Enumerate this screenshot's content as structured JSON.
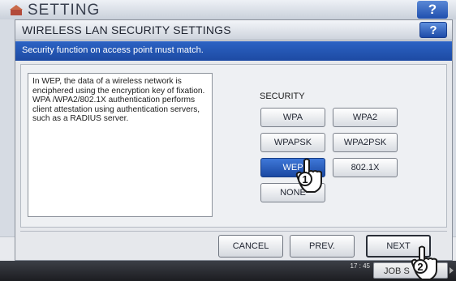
{
  "background": {
    "title": "SETTING",
    "help_label": "?",
    "taskbar": {
      "time": "17 : 45",
      "job_button": "JOB S"
    }
  },
  "dialog": {
    "title": "WIRELESS LAN SECURITY SETTINGS",
    "help_label": "?",
    "banner": "Security function on access point must match.",
    "description": "In WEP, the data of a wireless network is enciphered using the encryption key of fixation. WPA /WPA2/802.1X authentication performs client attestation using authentication servers, such as a RADIUS server.",
    "security_label": "SECURITY",
    "security_options": [
      {
        "label": "WPA",
        "selected": false
      },
      {
        "label": "WPA2",
        "selected": false
      },
      {
        "label": "WPAPSK",
        "selected": false
      },
      {
        "label": "WPA2PSK",
        "selected": false
      },
      {
        "label": "WEP",
        "selected": true
      },
      {
        "label": "802.1X",
        "selected": false
      },
      {
        "label": "NONE",
        "selected": false
      }
    ],
    "footer": {
      "cancel": "CANCEL",
      "prev": "PREV.",
      "next": "NEXT"
    },
    "callouts": [
      "1",
      "2"
    ]
  },
  "colors": {
    "accent": "#1d4aa3",
    "selected": "#2a5fc0"
  }
}
